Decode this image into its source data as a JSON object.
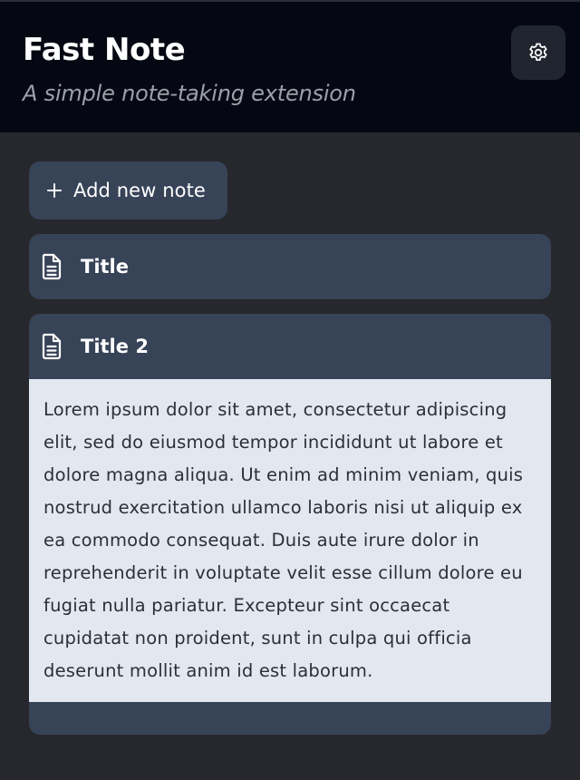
{
  "header": {
    "title": "Fast Note",
    "subtitle": "A simple note-taking extension",
    "settings_icon": "gear-icon"
  },
  "toolbar": {
    "add_label": "Add new note",
    "add_icon": "plus-icon"
  },
  "notes": [
    {
      "title": "Title",
      "icon": "document-icon",
      "expanded": false,
      "body": ""
    },
    {
      "title": "Title 2",
      "icon": "document-icon",
      "expanded": true,
      "body": "Lorem ipsum dolor sit amet, consectetur adipiscing elit, sed do eiusmod tempor incididunt ut labore et dolore magna aliqua. Ut enim ad minim veniam, quis nostrud exercitation ullamco laboris nisi ut aliquip ex ea commodo consequat. Duis aute irure dolor in reprehenderit in voluptate velit esse cillum dolore eu fugiat nulla pariatur. Excepteur sint occaecat cupidatat non proident, sunt in culpa qui officia deserunt mollit anim id est laborum."
    }
  ],
  "colors": {
    "header_bg": "#050812",
    "page_bg": "#27282d",
    "note_header_bg": "#374357",
    "note_body_bg": "#e3e8f0",
    "text_light": "#ffffff",
    "text_muted": "#9ca0aa"
  }
}
